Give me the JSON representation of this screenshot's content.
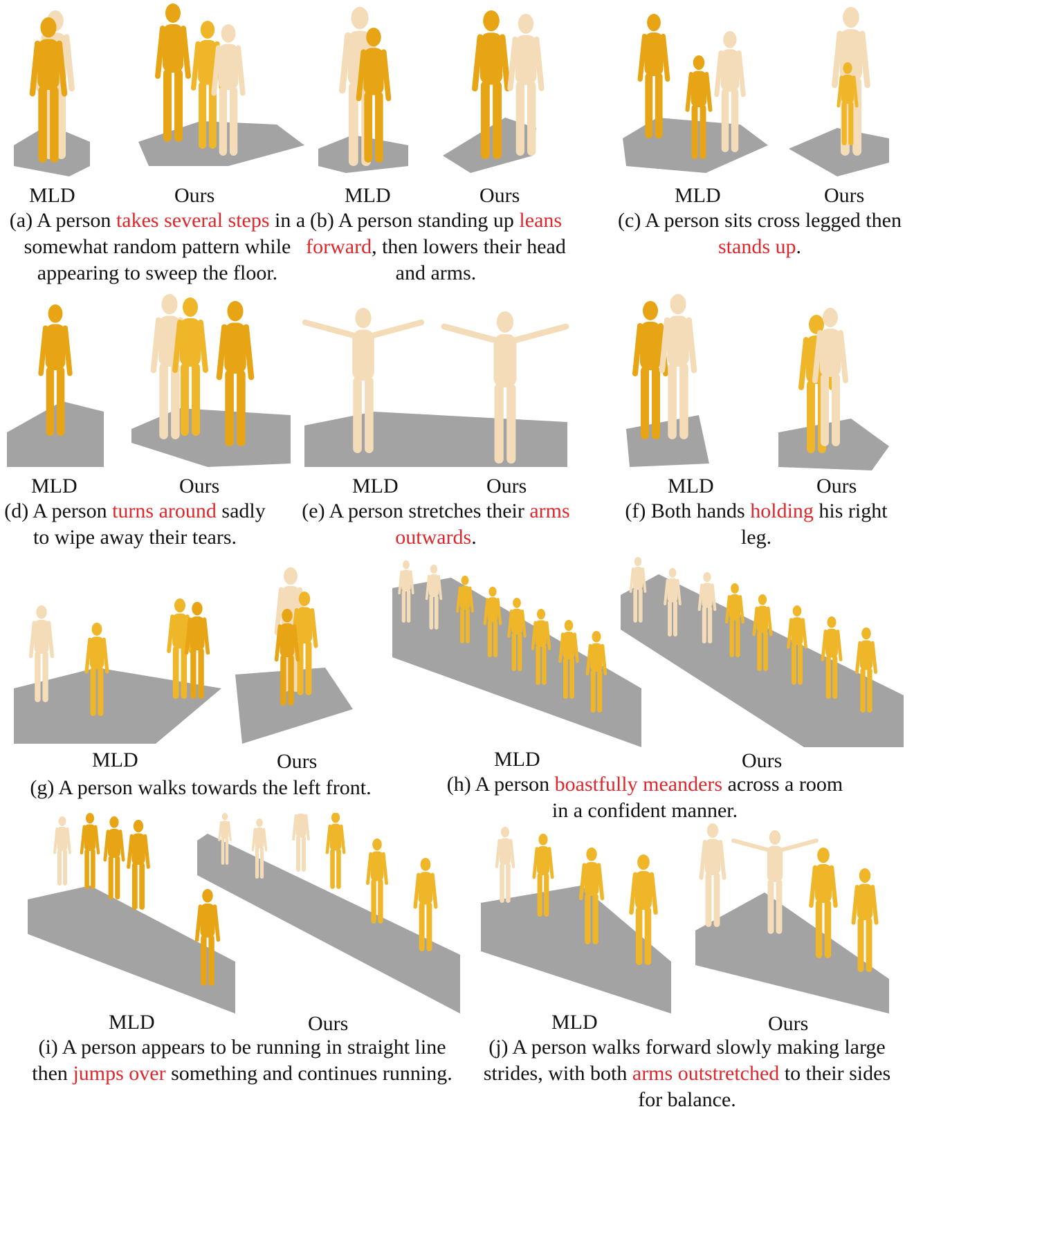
{
  "colors": {
    "ours_body": "#f0b62a",
    "mld_body": "#e7a515",
    "light_body": "#f3dcb7",
    "floor": "#a3a3a3",
    "highlight": "#e0262a"
  },
  "panels": [
    {
      "id": "a",
      "mld": "MLD",
      "ours": "Ours",
      "caption": [
        [
          "(a) A person ",
          false
        ],
        [
          "takes several steps",
          true
        ],
        [
          " in a somewhat random pattern while appearing to sweep the floor.",
          false
        ]
      ]
    },
    {
      "id": "b",
      "mld": "MLD",
      "ours": "Ours",
      "caption": [
        [
          "(b) A person standing up ",
          false
        ],
        [
          "leans forward",
          true
        ],
        [
          ", then lowers their head and arms.",
          false
        ]
      ]
    },
    {
      "id": "c",
      "mld": "MLD",
      "ours": "Ours",
      "caption": [
        [
          "(c) A person sits cross legged then ",
          false
        ],
        [
          "stands up",
          true
        ],
        [
          ".",
          false
        ]
      ]
    },
    {
      "id": "d",
      "mld": "MLD",
      "ours": "Ours",
      "caption": [
        [
          "(d) A person ",
          false
        ],
        [
          "turns around",
          true
        ],
        [
          " sadly to wipe away their tears.",
          false
        ]
      ]
    },
    {
      "id": "e",
      "mld": "MLD",
      "ours": "Ours",
      "caption": [
        [
          "(e) A person stretches their ",
          false
        ],
        [
          "arms outwards",
          true
        ],
        [
          ".",
          false
        ]
      ]
    },
    {
      "id": "f",
      "mld": "MLD",
      "ours": "Ours",
      "caption": [
        [
          "(f) Both hands ",
          false
        ],
        [
          "holding",
          true
        ],
        [
          " his right leg.",
          false
        ]
      ]
    },
    {
      "id": "g",
      "mld": "MLD",
      "ours": "Ours",
      "caption": [
        [
          "(g) A person walks towards the left front.",
          false
        ]
      ]
    },
    {
      "id": "h",
      "mld": "MLD",
      "ours": "Ours",
      "caption": [
        [
          "(h) A person ",
          false
        ],
        [
          "boastfully meanders",
          true
        ],
        [
          " across a room in a confident manner.",
          false
        ]
      ]
    },
    {
      "id": "i",
      "mld": "MLD",
      "ours": "Ours",
      "caption": [
        [
          "(i) A person appears to be running in straight line then ",
          false
        ],
        [
          "jumps over",
          true
        ],
        [
          " something and continues running.",
          false
        ]
      ]
    },
    {
      "id": "j",
      "mld": "MLD",
      "ours": "Ours",
      "caption": [
        [
          "(j) A person walks forward slowly making large strides, with both ",
          false
        ],
        [
          "arms outstretched",
          true
        ],
        [
          " to their sides for balance.",
          false
        ]
      ]
    }
  ]
}
